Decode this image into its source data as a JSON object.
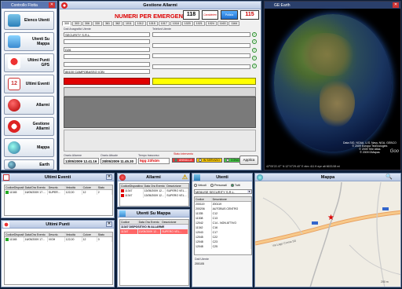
{
  "sidebar": {
    "title": "Controllo Flotta",
    "items": [
      {
        "label": "Elenco Utenti",
        "icon": "users-icon"
      },
      {
        "label": "Utenti Su Mappa",
        "icon": "map-users-icon"
      },
      {
        "label": "Ultimi Punti GPS",
        "icon": "gps-pin-icon"
      },
      {
        "label": "Ultimi Eventi",
        "icon": "calendar-icon"
      },
      {
        "label": "Allarmi",
        "icon": "alarm-icon"
      },
      {
        "label": "Gestione Allarmi",
        "icon": "alarm-manage-icon"
      },
      {
        "label": "Mappa",
        "icon": "map-icon"
      },
      {
        "label": "Earth",
        "icon": "earth-icon"
      }
    ]
  },
  "alarms_window": {
    "title": "Gestione Allarmi",
    "emergency_title": "NUMERI PER EMERGENZA",
    "emergency_logos": [
      "118",
      "Carabinieri",
      "Polizia",
      "115"
    ],
    "tabs": [
      "300",
      "303",
      "306",
      "330",
      "361",
      "362",
      "1011",
      "1012",
      "1015",
      "1017",
      "1018",
      "1020",
      "1021",
      "1024",
      "1163",
      "1164"
    ],
    "label_anagrafica": "Dati Anagrafici Utente",
    "label_telefoni": "Telefoni Utente",
    "user_name": "SECURITY S.R.L.",
    "user_code": "D26",
    "address": "86100 CAMPOBASSO (CB)",
    "label_orario_allarme": "Orario Allarme",
    "orario_allarme": "13/05/2009 12.41.16",
    "label_orario_attuale": "Orario Attuale",
    "orario_attuale": "28/05/2009 11.45.30",
    "label_tempo": "Tempo trascorso",
    "tempo": "5gg 23h4m",
    "label_stato": "Stato intervento",
    "stato_options": [
      "ANNULLA",
      "IN SERVIZIO",
      "CONCLUSO"
    ],
    "apply_label": "Applica"
  },
  "earth_window": {
    "title": "GE:Earth",
    "attribution": [
      "Data SIO, NOAA, U.S. Navy, NGA, GEBCO",
      "© 2009 Europa Technologies",
      "© 2009 Tele Atlas",
      "© 2009 DMapas"
    ],
    "status": "42°05'22.47\" N  12°47'29.40\" E    elev 411 ft    eye alt 6633.58 mi",
    "brand": "Goo"
  },
  "eventi_window": {
    "title": "Ultimi Eventi",
    "columns": [
      "CodiceDispositivo",
      "Data/Ora Evento",
      "Descriz.",
      "Velocità",
      "Colore",
      "Stato"
    ],
    "rows": [
      [
        "11345",
        "16/05/2009 17....",
        "SUPER...",
        "122,00",
        "12",
        "2"
      ]
    ]
  },
  "punti_window": {
    "title": "Ultimi Punti",
    "columns": [
      "CodiceDispositivo",
      "Data/Ora Evento",
      "Descriz.",
      "Velocità",
      "Colore",
      "Stato"
    ],
    "rows": [
      [
        "11345",
        "16/05/2009 17...",
        "VIGH",
        "122,00",
        "12",
        "0"
      ]
    ]
  },
  "allarmi_window": {
    "title": "Allarmi",
    "columns": [
      "CodiceDispositivo",
      "Data Ora Evento",
      "Descrizione"
    ],
    "rows": [
      [
        "11347",
        "13/05/2009 12...",
        "SUPERO VEL..."
      ],
      [
        "11347",
        "13/05/2009 12...",
        "SUPERO VEL..."
      ]
    ]
  },
  "utenti_mappa_window": {
    "title": "Utenti Su Mappa",
    "columns": [
      "Codice",
      "Data Ora Evento",
      "Descrizione"
    ],
    "group_row": "11347 DISPOSITIVO IN ALLARME",
    "rows": [
      [
        "11347",
        "13/05/2009 12...",
        "SUPERO VEL..."
      ]
    ]
  },
  "utenti_window": {
    "title": "Utenti",
    "radios": [
      "Veicoli",
      "Personali",
      "Tutti"
    ],
    "selected_radio": "Tutti",
    "select_value": "ME6USE SECURITY S.R.L.",
    "columns": [
      "Codice",
      "Descrizione"
    ],
    "rows": [
      [
        "200119",
        "200119"
      ],
      [
        "200206",
        "AUTOBUS CENTRO"
      ],
      [
        "11335",
        "C12"
      ],
      [
        "11308",
        "C13"
      ],
      [
        "12042",
        "C14 - NON ATTIVO"
      ],
      [
        "11342",
        "C16"
      ],
      [
        "12043",
        "C17"
      ],
      [
        "12045",
        "C22"
      ],
      [
        "12048",
        "C23"
      ],
      [
        "12048",
        "C25"
      ]
    ],
    "footer_label": "Dati Utente",
    "footer_value": "200105"
  },
  "mappa_window": {
    "title": "Mappa",
    "road_label": "Via Lago Crema SS",
    "scale": "200 m"
  }
}
